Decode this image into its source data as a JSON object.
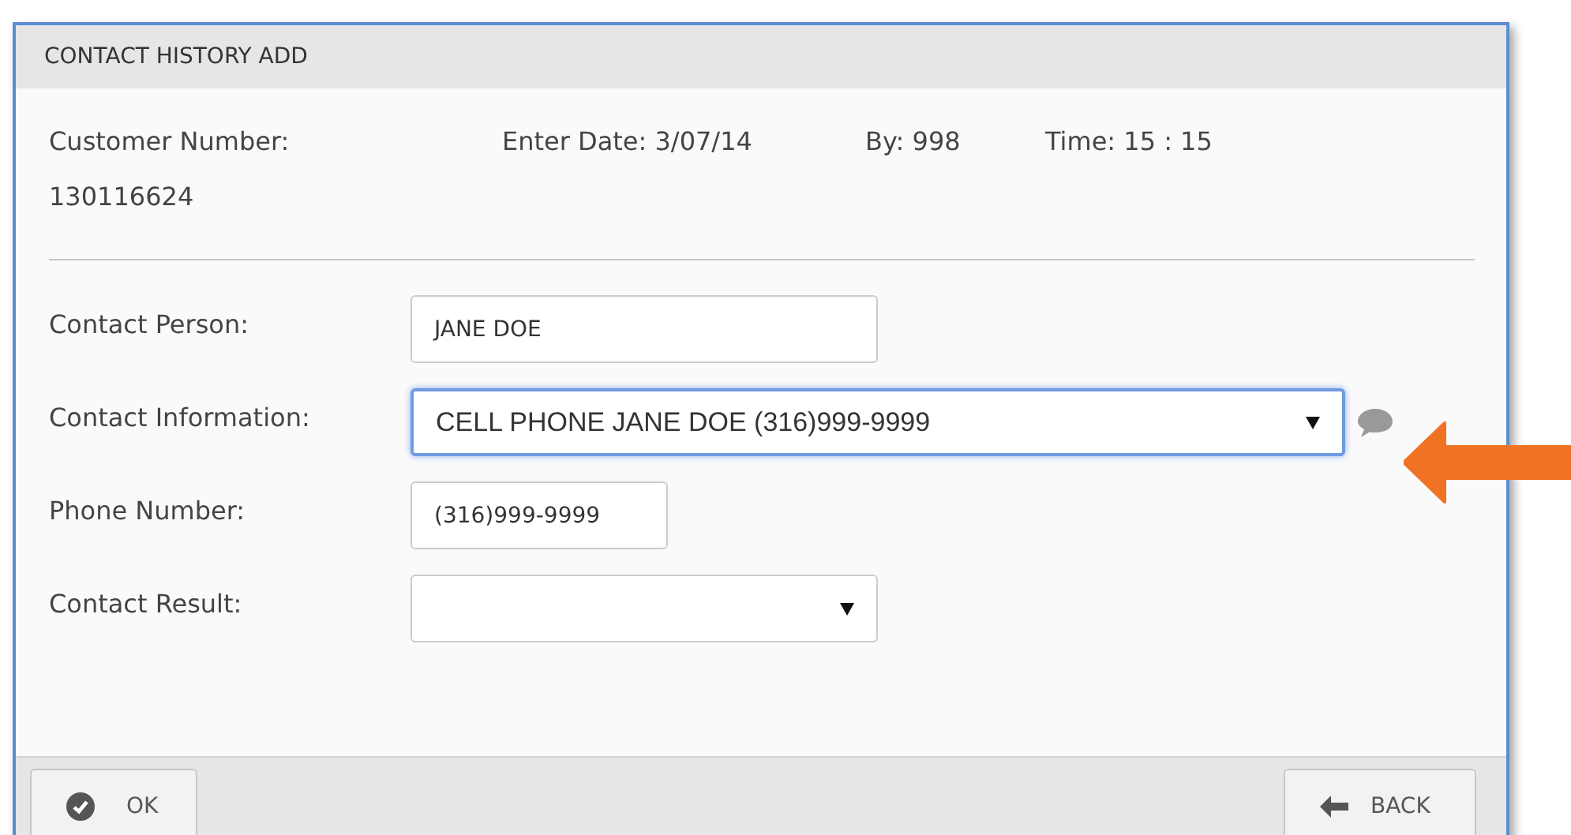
{
  "window": {
    "title": "CONTACT HISTORY ADD"
  },
  "info": {
    "customer_number_label": "Customer Number:",
    "customer_number": "130116624",
    "enter_date": "Enter Date: 3/07/14",
    "by": "By: 998",
    "time": "Time: 15 : 15"
  },
  "fields": [
    {
      "label": "Contact Person:",
      "kind": "text",
      "value": "JANE DOE",
      "focused": false
    },
    {
      "label": "Contact Information:",
      "kind": "select",
      "value": "CELL PHONE JANE DOE (316)999-9999",
      "focused": true,
      "comment_icon": true
    },
    {
      "label": "Phone Number:",
      "kind": "text",
      "value": "(316)999-9999",
      "focused": false
    },
    {
      "label": "Contact Result:",
      "kind": "select",
      "focused": false
    }
  ],
  "annotation": {
    "arrow": true
  },
  "buttons": [
    {
      "label": "OK",
      "kind": "ok"
    },
    {
      "label": "BACK",
      "kind": "back"
    }
  ]
}
